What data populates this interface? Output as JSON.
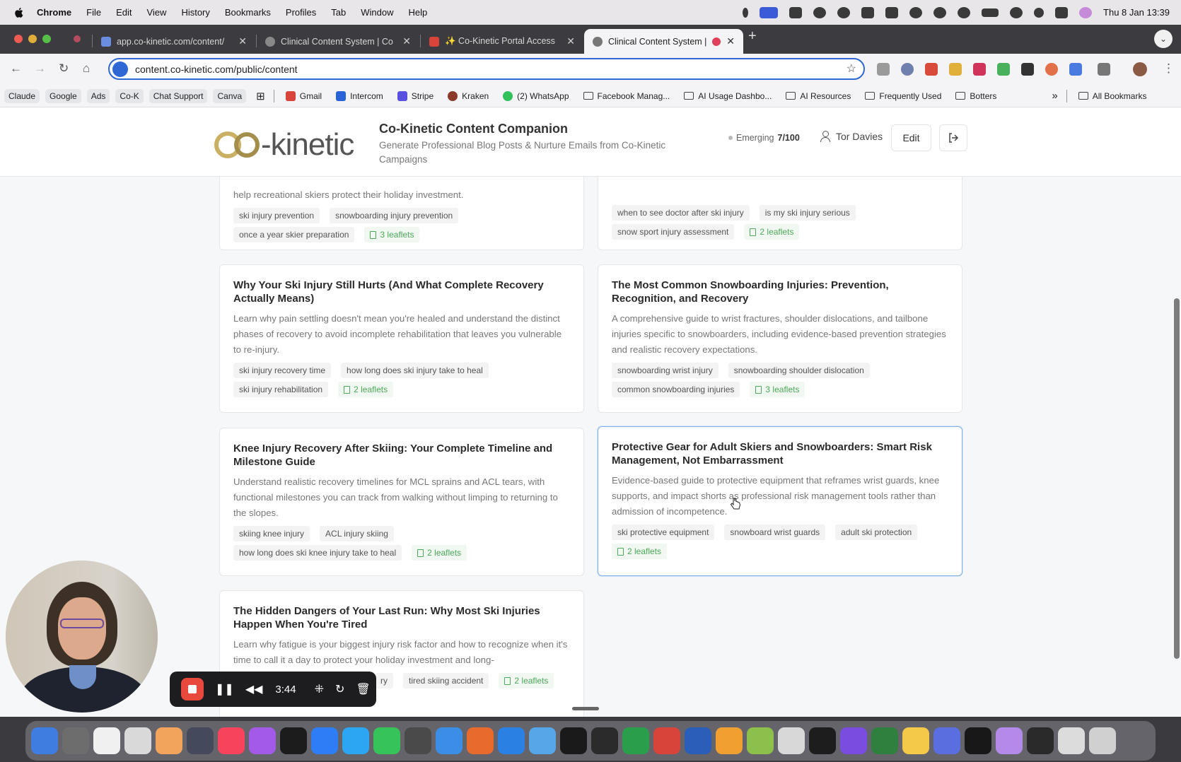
{
  "menubar": {
    "app_name": "Chrome",
    "items": [
      "File",
      "Edit",
      "View",
      "History",
      "Bookmarks",
      "Profiles",
      "Tab",
      "Window",
      "Help"
    ],
    "clock": "Thu 8 Jan  13:39"
  },
  "tabs": [
    {
      "title": "app.co-kinetic.com/content/",
      "favicon_color": "#6a8de0"
    },
    {
      "title": "Clinical Content System | Co",
      "favicon_color": "#888888"
    },
    {
      "title": "✨ Co-Kinetic Portal Access",
      "favicon_color": "#d8443a"
    },
    {
      "title": "Clinical Content System |",
      "favicon_color": "#777777"
    }
  ],
  "omnibox": {
    "url": "content.co-kinetic.com/public/content"
  },
  "bookmarks": {
    "pills": [
      "Claude",
      "Google",
      "Ads",
      "Co-K",
      "Chat Support",
      "Canva"
    ],
    "items": [
      "Gmail",
      "Intercom",
      "Stripe",
      "Kraken",
      "(2) WhatsApp"
    ],
    "folders": [
      "Facebook Manag...",
      "AI Usage Dashbo...",
      "AI Resources",
      "Frequently Used",
      "Botters"
    ],
    "all_bookmarks": "All Bookmarks",
    "overflow": "»"
  },
  "header": {
    "logo_text": "-kinetic",
    "title": "Co-Kinetic Content Companion",
    "subtitle": "Generate Professional Blog Posts & Nurture Emails from Co-Kinetic Campaigns",
    "status_label": "Emerging",
    "status_score": "7/100",
    "user_name": "Tor Davies",
    "edit_label": "Edit",
    "logout_icon": "logout-icon"
  },
  "cards": [
    {
      "title": "",
      "description": "help recreational skiers protect their holiday investment.",
      "tags": [
        "ski injury prevention",
        "snowboarding injury prevention",
        "once a year skier preparation"
      ],
      "leaflets": "3 leaflets"
    },
    {
      "title": "",
      "description": "",
      "tags": [
        "when to see doctor after ski injury",
        "is my ski injury serious",
        "snow sport injury assessment"
      ],
      "leaflets": "2 leaflets"
    },
    {
      "title": "Why Your Ski Injury Still Hurts (And What Complete Recovery Actually Means)",
      "description": "Learn why pain settling doesn't mean you're healed and understand the distinct phases of recovery to avoid incomplete rehabilitation that leaves you vulnerable to re-injury.",
      "tags": [
        "ski injury recovery time",
        "how long does ski injury take to heal",
        "ski injury rehabilitation"
      ],
      "leaflets": "2 leaflets"
    },
    {
      "title": "The Most Common Snowboarding Injuries: Prevention, Recognition, and Recovery",
      "description": "A comprehensive guide to wrist fractures, shoulder dislocations, and tailbone injuries specific to snowboarders, including evidence-based prevention strategies and realistic recovery expectations.",
      "tags": [
        "snowboarding wrist injury",
        "snowboarding shoulder dislocation",
        "common snowboarding injuries"
      ],
      "leaflets": "3 leaflets"
    },
    {
      "title": "Knee Injury Recovery After Skiing: Your Complete Timeline and Milestone Guide",
      "description": "Understand realistic recovery timelines for MCL sprains and ACL tears, with functional milestones you can track from walking without limping to returning to the slopes.",
      "tags": [
        "skiing knee injury",
        "ACL injury skiing",
        "how long does ski knee injury take to heal"
      ],
      "leaflets": "2 leaflets"
    },
    {
      "title": "Protective Gear for Adult Skiers and Snowboarders: Smart Risk Management, Not Embarrassment",
      "description": "Evidence-based guide to protective equipment that reframes wrist guards, knee supports, and impact shorts as professional risk management tools rather than admission of incompetence.",
      "tags": [
        "ski protective equipment",
        "snowboard wrist guards",
        "adult ski protection"
      ],
      "leaflets": "2 leaflets"
    },
    {
      "title": "The Hidden Dangers of Your Last Run: Why Most Ski Injuries Happen When You're Tired",
      "description": "Learn why fatigue is your biggest injury risk factor and how to recognize when it's time to call it a day to protect your holiday investment and long-",
      "tags": [
        "ry",
        "tired skiing accident"
      ],
      "leaflets": "2 leaflets"
    }
  ],
  "recorder": {
    "time": "3:44"
  },
  "dock_colors": [
    "#3f7ee0",
    "#6d6d6d",
    "#f0f0f0",
    "#d9d9d9",
    "#f2a35c",
    "#444a5c",
    "#f7435c",
    "#a35ae6",
    "#1c1c1c",
    "#2f7df6",
    "#2aa7f0",
    "#36c35a",
    "#4a4a4a",
    "#3b8de6",
    "#e86a2c",
    "#2b80e4",
    "#56a6e8",
    "#1a1a1a",
    "#2b2b2b",
    "#2a9e4a",
    "#d8443a",
    "#2b5eb8",
    "#f0a030",
    "#8cc04a",
    "#d8d8d8",
    "#1d1d1d",
    "#7a4ce0",
    "#2f7f3f",
    "#f3c94a",
    "#5a6ee0",
    "#181818",
    "#b38ae8",
    "#2a2a2a",
    "#dcdcdc",
    "#d0d0d0"
  ]
}
